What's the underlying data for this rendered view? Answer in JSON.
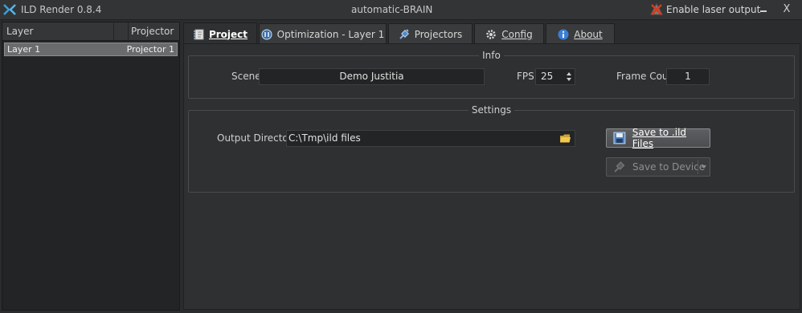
{
  "window": {
    "app_title": "ILD Render 0.8.4",
    "title": "automatic-BRAIN",
    "laser_output_label": "Enable laser output",
    "minimize_glyph": "_",
    "close_glyph": "X"
  },
  "layers": {
    "columns": [
      "Layer",
      "Projector"
    ],
    "rows": [
      {
        "layer": "Layer 1",
        "projector": "Projector 1"
      }
    ]
  },
  "tabs": [
    {
      "label": "Project",
      "icon": "notebook-icon",
      "active": true
    },
    {
      "label": "Optimization - Layer 1",
      "icon": "wrench-icon",
      "active": false
    },
    {
      "label": "Projectors",
      "icon": "plug-icon",
      "active": false
    },
    {
      "label": "Config",
      "icon": "gear-icon",
      "active": false
    },
    {
      "label": "About",
      "icon": "info-icon",
      "active": false
    }
  ],
  "info": {
    "title": "Info",
    "scene_label": "Scene",
    "scene_value": "Demo Justitia",
    "fps_label": "FPS",
    "fps_value": "25",
    "frame_count_label": "Frame Count",
    "frame_count_value": "1"
  },
  "settings": {
    "title": "Settings",
    "output_dir_label": "Output Directory",
    "output_dir_value": "C:\\Tmp\\ild files",
    "save_ild_label": "Save to .ild Files",
    "save_device_label": "Save to Device"
  },
  "colors": {
    "background": "#2b2c2e",
    "panel": "#2f3032",
    "selected_row": "#6a6b6d",
    "laser_icon": "#d83a1a",
    "info_icon": "#3b7fd6",
    "folder_icon": "#e8c14a"
  }
}
